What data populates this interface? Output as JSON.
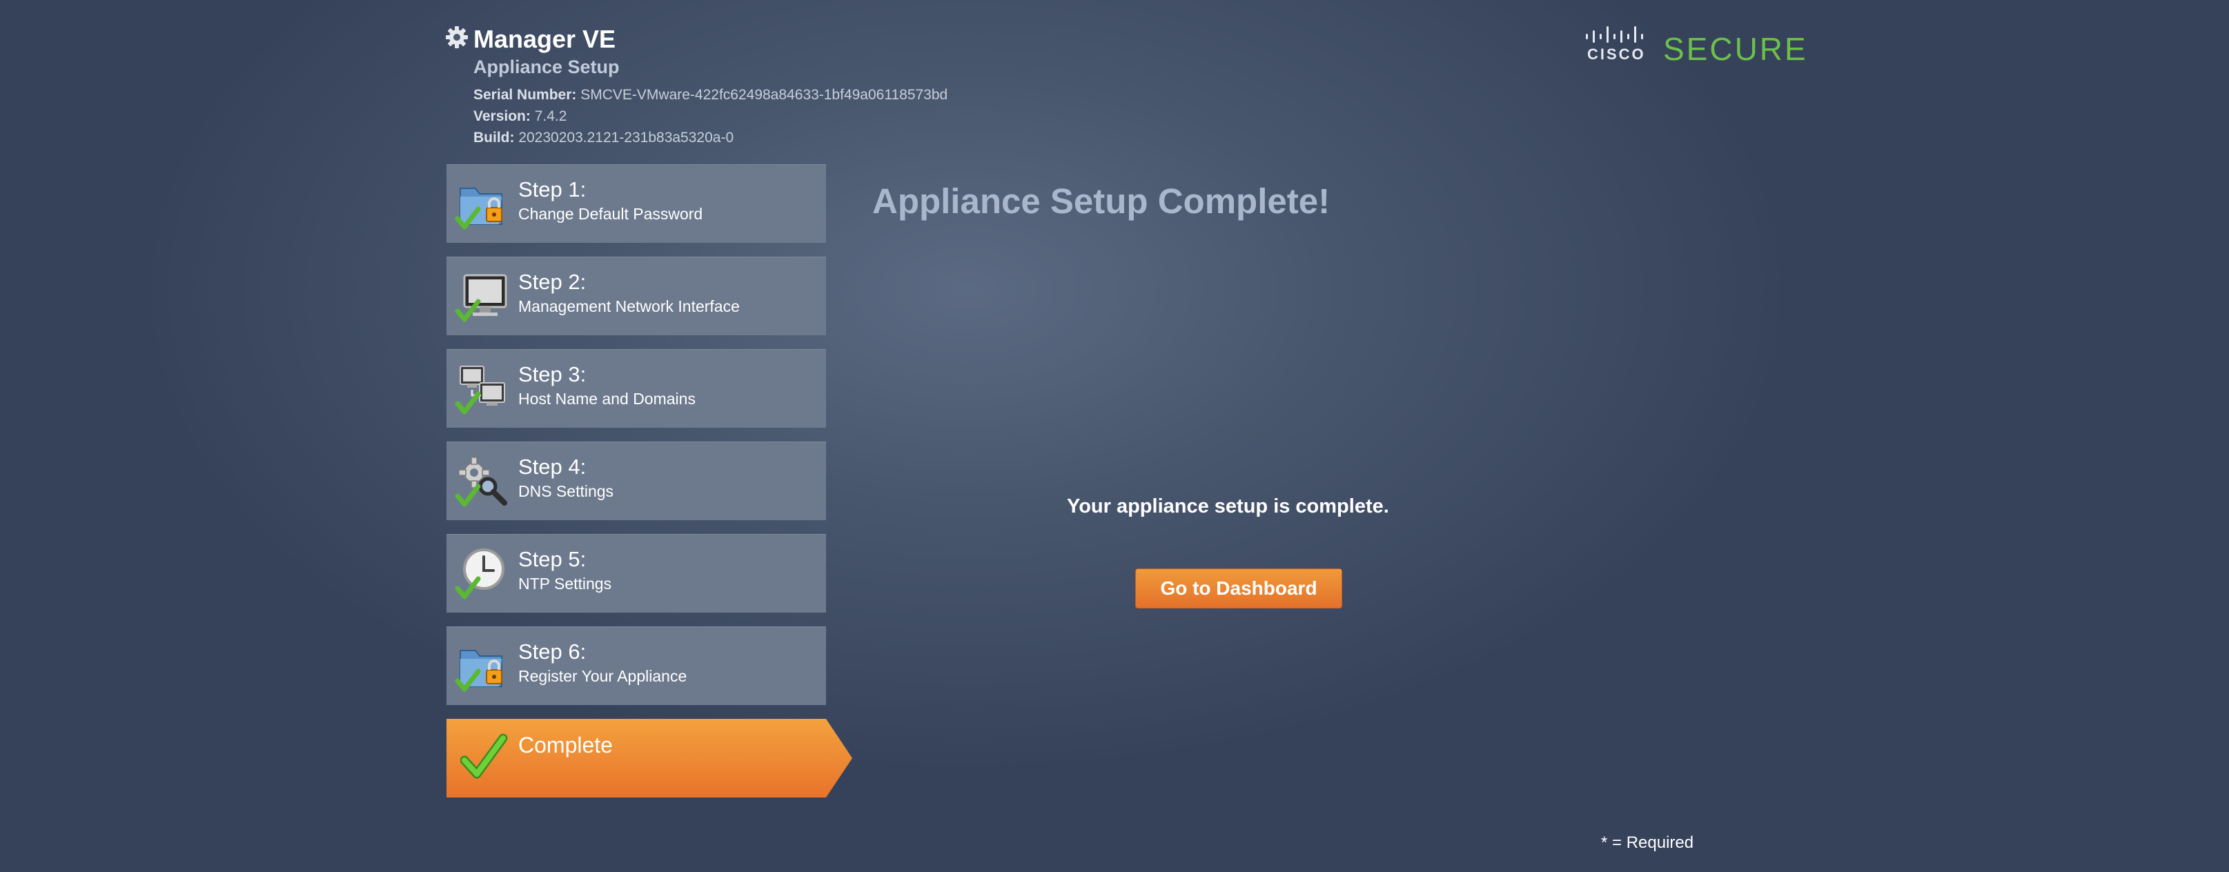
{
  "header": {
    "title": "Manager VE",
    "subtitle": "Appliance Setup",
    "serial_label": "Serial Number:",
    "serial_value": "SMCVE-VMware-422fc62498a84633-1bf49a06118573bd",
    "version_label": "Version:",
    "version_value": "7.4.2",
    "build_label": "Build:",
    "build_value": "20230203.2121-231b83a5320a-0"
  },
  "brand": {
    "cisco": "CISCO",
    "secure": "SECURE",
    "secure_color": "#6cc04a"
  },
  "steps": [
    {
      "title": "Step 1:",
      "desc": "Change Default Password",
      "icon": "folder-lock-icon",
      "done": true
    },
    {
      "title": "Step 2:",
      "desc": "Management Network Interface",
      "icon": "monitor-icon",
      "done": true
    },
    {
      "title": "Step 3:",
      "desc": "Host Name and Domains",
      "icon": "network-computers-icon",
      "done": true
    },
    {
      "title": "Step 4:",
      "desc": "DNS Settings",
      "icon": "gear-search-icon",
      "done": true
    },
    {
      "title": "Step 5:",
      "desc": "NTP Settings",
      "icon": "clock-icon",
      "done": true
    },
    {
      "title": "Step 6:",
      "desc": "Register Your Appliance",
      "icon": "folder-lock-icon",
      "done": true
    }
  ],
  "complete_step": {
    "title": "Complete",
    "active": true,
    "color": "#e8732a"
  },
  "main": {
    "heading": "Appliance Setup Complete!",
    "message": "Your appliance setup is complete.",
    "button_label": "Go to Dashboard",
    "required_note": "* = Required"
  }
}
